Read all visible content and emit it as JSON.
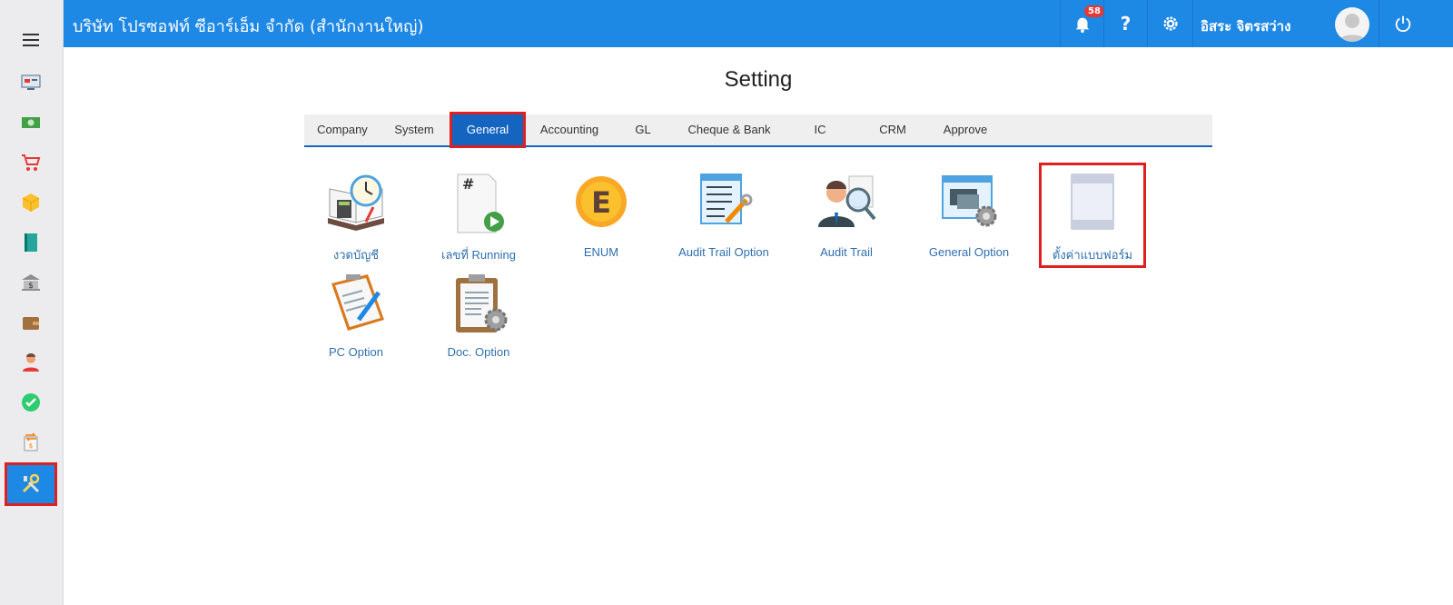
{
  "header": {
    "company": "บริษัท โปรซอฟท์ ซีอาร์เอ็ม จำกัด (สำนักงานใหญ่)",
    "notification_count": "58",
    "help_label": "?",
    "user_name": "อิสระ จิตรสว่าง"
  },
  "page": {
    "title": "Setting"
  },
  "tabs": [
    {
      "label": "Company"
    },
    {
      "label": "System"
    },
    {
      "label": "General"
    },
    {
      "label": "Accounting"
    },
    {
      "label": "GL"
    },
    {
      "label": "Cheque & Bank"
    },
    {
      "label": "IC"
    },
    {
      "label": "CRM"
    },
    {
      "label": "Approve"
    }
  ],
  "tiles": [
    {
      "label": "งวดบัญชี"
    },
    {
      "label": "เลขที่ Running"
    },
    {
      "label": "ENUM"
    },
    {
      "label": "Audit Trail Option"
    },
    {
      "label": "Audit Trail"
    },
    {
      "label": "General Option"
    },
    {
      "label": "ตั้งค่าแบบฟอร์ม"
    },
    {
      "label": "PC Option"
    },
    {
      "label": "Doc. Option"
    }
  ],
  "colors": {
    "primary": "#1e88e5",
    "tab_active": "#1565c0",
    "highlight": "#e02020",
    "link": "#2f6fb0"
  }
}
